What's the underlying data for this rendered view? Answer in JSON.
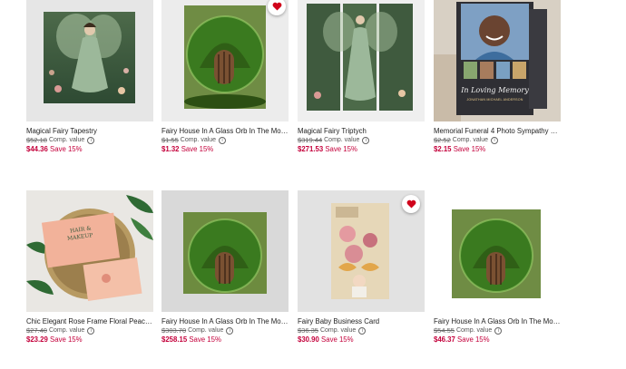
{
  "products": [
    {
      "title": "Magical Fairy Tapestry",
      "orig_price": "$52.18",
      "comp": "Comp. value",
      "sale_price": "$44.36",
      "save": "Save 15%",
      "favorited": false
    },
    {
      "title": "Fairy House In A Glass Orb In The Mossy...",
      "orig_price": "$1.55",
      "comp": "Comp. value",
      "sale_price": "$1.32",
      "save": "Save 15%",
      "favorited": true
    },
    {
      "title": "Magical Fairy Triptych",
      "orig_price": "$319.44",
      "comp": "Comp. value",
      "sale_price": "$271.53",
      "save": "Save 15%",
      "favorited": false
    },
    {
      "title": "Memorial Funeral 4 Photo Sympathy Pra...",
      "orig_price": "$2.52",
      "comp": "Comp. value",
      "sale_price": "$2.15",
      "save": "Save 15%",
      "favorited": false,
      "card_text": {
        "script": "In Loving Memory",
        "name": "JONATHAN MICHAEL ANDERSON"
      }
    },
    {
      "title": "Chic Elegant Rose Frame Floral Peach F...",
      "orig_price": "$27.40",
      "comp": "Comp. value",
      "sale_price": "$23.29",
      "save": "Save 15%",
      "favorited": false,
      "card_text": {
        "line1": "HAIR &",
        "line2": "MAKEUP"
      },
      "swatches": [
        "#f3a98a",
        "#f2b9bd",
        "#a9d6c4",
        "none"
      ]
    },
    {
      "title": "Fairy House In A Glass Orb In The Mossy...",
      "orig_price": "$303.70",
      "comp": "Comp. value",
      "sale_price": "$258.15",
      "save": "Save 15%",
      "favorited": false
    },
    {
      "title": "Fairy Baby Business Card",
      "orig_price": "$36.35",
      "comp": "Comp. value",
      "sale_price": "$30.90",
      "save": "Save 15%",
      "favorited": true
    },
    {
      "title": "Fairy House In A Glass Orb In The Mossy...",
      "orig_price": "$54.55",
      "comp": "Comp. value",
      "sale_price": "$46.37",
      "save": "Save 15%",
      "favorited": false
    }
  ],
  "colors": {
    "sale": "#c4003b",
    "heart": "#d0021b"
  },
  "icons": {
    "favorite": "heart-icon",
    "info": "info-icon"
  }
}
